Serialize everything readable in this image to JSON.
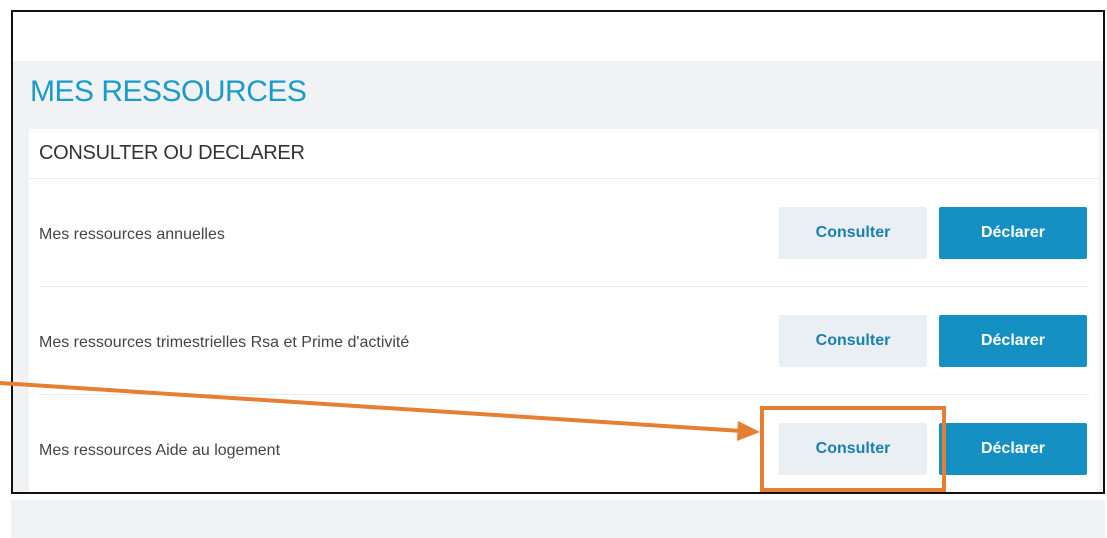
{
  "page": {
    "title": "MES RESSOURCES"
  },
  "card": {
    "title": "CONSULTER OU DECLARER",
    "rows": [
      {
        "label": "Mes ressources annuelles",
        "consult_label": "Consulter",
        "declare_label": "Déclarer"
      },
      {
        "label": "Mes ressources trimestrielles Rsa et Prime d'activité",
        "consult_label": "Consulter",
        "declare_label": "Déclarer"
      },
      {
        "label": "Mes ressources Aide au logement",
        "consult_label": "Consulter",
        "declare_label": "Déclarer"
      }
    ]
  },
  "annotation": {
    "color": "#e67e33",
    "target": "Consulter (Aide au logement)"
  },
  "colors": {
    "title_blue": "#1a9bc9",
    "primary_button": "#1590c3",
    "secondary_button_bg": "#eaeff4",
    "panel_bg": "#f0f2f4"
  }
}
